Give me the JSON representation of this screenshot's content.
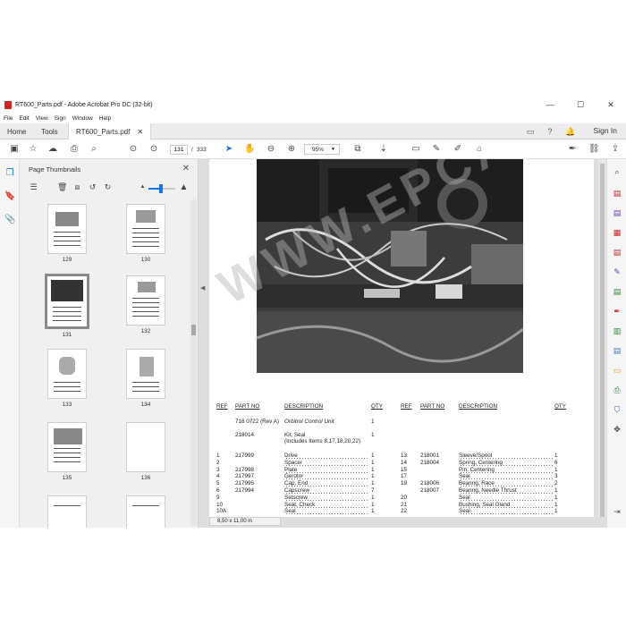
{
  "window": {
    "title": "RT600_Parts.pdf - Adobe Acrobat Pro DC (32-bit)",
    "minimize": "—",
    "maximize": "☐",
    "close": "✕"
  },
  "menu": [
    "File",
    "Edit",
    "View",
    "Sign",
    "Window",
    "Help"
  ],
  "tabs": {
    "home": "Home",
    "tools": "Tools",
    "document": "RT600_Parts.pdf"
  },
  "account": {
    "sign_in": "Sign In"
  },
  "toolbar": {
    "current_page": "131",
    "page_separator": "/",
    "page_count": "333",
    "zoom": "95%"
  },
  "thumbnails_panel": {
    "title": "Page Thumbnails",
    "zoom_level": 0.45,
    "pages": [
      "129",
      "130",
      "131",
      "132",
      "133",
      "134",
      "135",
      "136"
    ],
    "selected_page": "131"
  },
  "document": {
    "page_size": "8,50 x 11,00 in",
    "watermark": "WWW.EPCATALOGS.COM",
    "table_headers": {
      "ref": "REF",
      "part_no": "PART NO",
      "description": "DESCRIPTION",
      "qty": "QTY"
    },
    "assembly": {
      "part_no": "718 0722 (Rev A)",
      "description": "Orbitrol Control Unit",
      "qty": "1"
    },
    "kit": {
      "part_no": "218014",
      "description": "Kit, Seal",
      "qty": "1",
      "note": "(Includes Items 8,17,18,20,22)"
    },
    "left_rows": [
      {
        "ref": "1",
        "part_no": "217999",
        "description": "Drive",
        "qty": "1"
      },
      {
        "ref": "2",
        "part_no": "",
        "description": "Spacer",
        "qty": "1"
      },
      {
        "ref": "3",
        "part_no": "217998",
        "description": "Plate",
        "qty": "1"
      },
      {
        "ref": "4",
        "part_no": "217997",
        "description": "Gerotor",
        "qty": "1"
      },
      {
        "ref": "5",
        "part_no": "217995",
        "description": "Cap, End",
        "qty": "1"
      },
      {
        "ref": "6",
        "part_no": "217994",
        "description": "Capscrew",
        "qty": "7"
      },
      {
        "ref": "9",
        "part_no": "",
        "description": "Setscrew",
        "qty": "1"
      },
      {
        "ref": "10",
        "part_no": "",
        "description": "Seat, Check",
        "qty": "1"
      },
      {
        "ref": "10A",
        "part_no": "",
        "description": "Seal",
        "qty": "1"
      }
    ],
    "right_rows": [
      {
        "ref": "13",
        "part_no": "218001",
        "description": "Sleeve/Spool",
        "qty": "1"
      },
      {
        "ref": "14",
        "part_no": "218004",
        "description": "Spring, Centering",
        "qty": "6"
      },
      {
        "ref": "15",
        "part_no": "",
        "description": "Pin, Centering",
        "qty": "1"
      },
      {
        "ref": "17",
        "part_no": "",
        "description": "Seal",
        "qty": "3"
      },
      {
        "ref": "19",
        "part_no": "218006",
        "description": "Bearing, Race",
        "qty": "2"
      },
      {
        "ref": "",
        "part_no": "218007",
        "description": "Bearing, Needle Thrust",
        "qty": "1"
      },
      {
        "ref": "20",
        "part_no": "",
        "description": "Seal",
        "qty": "1"
      },
      {
        "ref": "21",
        "part_no": "",
        "description": "Bushing, Seal Gland",
        "qty": "1"
      },
      {
        "ref": "22",
        "part_no": "",
        "description": "Seal",
        "qty": "1"
      }
    ]
  }
}
